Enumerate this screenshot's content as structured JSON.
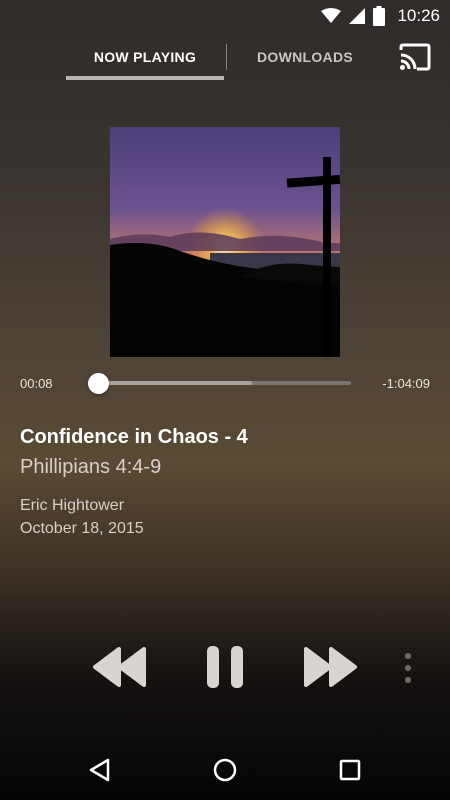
{
  "status_bar": {
    "time": "10:26",
    "icons": [
      "wifi-icon",
      "cell-signal-icon",
      "battery-icon"
    ]
  },
  "tabs": {
    "now_playing": "NOW PLAYING",
    "downloads": "DOWNLOADS",
    "active": "now_playing"
  },
  "cast": {
    "icon": "cast-icon"
  },
  "player": {
    "elapsed": "00:08",
    "remaining": "-1:04:09",
    "progress": 0.0,
    "buffered": 0.61
  },
  "track": {
    "title": "Confidence in Chaos - 4",
    "passage": "Phillipians 4:4-9",
    "speaker": "Eric Hightower",
    "date": "October 18, 2015"
  },
  "controls": [
    "rewind-icon",
    "pause-icon",
    "fast-forward-icon",
    "more-vertical-icon"
  ],
  "nav": [
    "back-icon",
    "home-icon",
    "recents-icon"
  ],
  "colors": {
    "background_top": "#2f2b2a",
    "background_mid": "#5a4a35",
    "background_bottom": "#050505",
    "controls": "#d8d4d0"
  }
}
